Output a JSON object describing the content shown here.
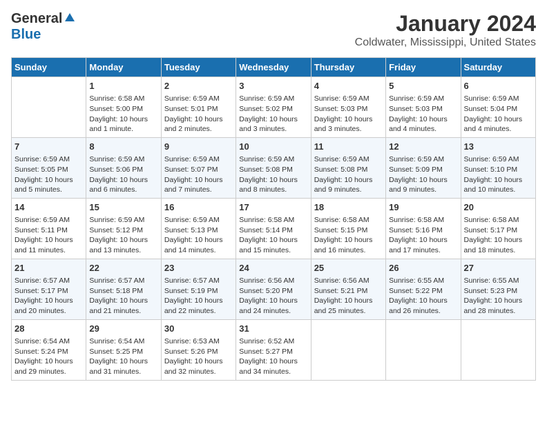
{
  "logo": {
    "general": "General",
    "blue": "Blue"
  },
  "title": "January 2024",
  "subtitle": "Coldwater, Mississippi, United States",
  "headers": [
    "Sunday",
    "Monday",
    "Tuesday",
    "Wednesday",
    "Thursday",
    "Friday",
    "Saturday"
  ],
  "weeks": [
    [
      {
        "day": "",
        "info": ""
      },
      {
        "day": "1",
        "info": "Sunrise: 6:58 AM\nSunset: 5:00 PM\nDaylight: 10 hours\nand 1 minute."
      },
      {
        "day": "2",
        "info": "Sunrise: 6:59 AM\nSunset: 5:01 PM\nDaylight: 10 hours\nand 2 minutes."
      },
      {
        "day": "3",
        "info": "Sunrise: 6:59 AM\nSunset: 5:02 PM\nDaylight: 10 hours\nand 3 minutes."
      },
      {
        "day": "4",
        "info": "Sunrise: 6:59 AM\nSunset: 5:03 PM\nDaylight: 10 hours\nand 3 minutes."
      },
      {
        "day": "5",
        "info": "Sunrise: 6:59 AM\nSunset: 5:03 PM\nDaylight: 10 hours\nand 4 minutes."
      },
      {
        "day": "6",
        "info": "Sunrise: 6:59 AM\nSunset: 5:04 PM\nDaylight: 10 hours\nand 4 minutes."
      }
    ],
    [
      {
        "day": "7",
        "info": "Sunrise: 6:59 AM\nSunset: 5:05 PM\nDaylight: 10 hours\nand 5 minutes."
      },
      {
        "day": "8",
        "info": "Sunrise: 6:59 AM\nSunset: 5:06 PM\nDaylight: 10 hours\nand 6 minutes."
      },
      {
        "day": "9",
        "info": "Sunrise: 6:59 AM\nSunset: 5:07 PM\nDaylight: 10 hours\nand 7 minutes."
      },
      {
        "day": "10",
        "info": "Sunrise: 6:59 AM\nSunset: 5:08 PM\nDaylight: 10 hours\nand 8 minutes."
      },
      {
        "day": "11",
        "info": "Sunrise: 6:59 AM\nSunset: 5:08 PM\nDaylight: 10 hours\nand 9 minutes."
      },
      {
        "day": "12",
        "info": "Sunrise: 6:59 AM\nSunset: 5:09 PM\nDaylight: 10 hours\nand 9 minutes."
      },
      {
        "day": "13",
        "info": "Sunrise: 6:59 AM\nSunset: 5:10 PM\nDaylight: 10 hours\nand 10 minutes."
      }
    ],
    [
      {
        "day": "14",
        "info": "Sunrise: 6:59 AM\nSunset: 5:11 PM\nDaylight: 10 hours\nand 11 minutes."
      },
      {
        "day": "15",
        "info": "Sunrise: 6:59 AM\nSunset: 5:12 PM\nDaylight: 10 hours\nand 13 minutes."
      },
      {
        "day": "16",
        "info": "Sunrise: 6:59 AM\nSunset: 5:13 PM\nDaylight: 10 hours\nand 14 minutes."
      },
      {
        "day": "17",
        "info": "Sunrise: 6:58 AM\nSunset: 5:14 PM\nDaylight: 10 hours\nand 15 minutes."
      },
      {
        "day": "18",
        "info": "Sunrise: 6:58 AM\nSunset: 5:15 PM\nDaylight: 10 hours\nand 16 minutes."
      },
      {
        "day": "19",
        "info": "Sunrise: 6:58 AM\nSunset: 5:16 PM\nDaylight: 10 hours\nand 17 minutes."
      },
      {
        "day": "20",
        "info": "Sunrise: 6:58 AM\nSunset: 5:17 PM\nDaylight: 10 hours\nand 18 minutes."
      }
    ],
    [
      {
        "day": "21",
        "info": "Sunrise: 6:57 AM\nSunset: 5:17 PM\nDaylight: 10 hours\nand 20 minutes."
      },
      {
        "day": "22",
        "info": "Sunrise: 6:57 AM\nSunset: 5:18 PM\nDaylight: 10 hours\nand 21 minutes."
      },
      {
        "day": "23",
        "info": "Sunrise: 6:57 AM\nSunset: 5:19 PM\nDaylight: 10 hours\nand 22 minutes."
      },
      {
        "day": "24",
        "info": "Sunrise: 6:56 AM\nSunset: 5:20 PM\nDaylight: 10 hours\nand 24 minutes."
      },
      {
        "day": "25",
        "info": "Sunrise: 6:56 AM\nSunset: 5:21 PM\nDaylight: 10 hours\nand 25 minutes."
      },
      {
        "day": "26",
        "info": "Sunrise: 6:55 AM\nSunset: 5:22 PM\nDaylight: 10 hours\nand 26 minutes."
      },
      {
        "day": "27",
        "info": "Sunrise: 6:55 AM\nSunset: 5:23 PM\nDaylight: 10 hours\nand 28 minutes."
      }
    ],
    [
      {
        "day": "28",
        "info": "Sunrise: 6:54 AM\nSunset: 5:24 PM\nDaylight: 10 hours\nand 29 minutes."
      },
      {
        "day": "29",
        "info": "Sunrise: 6:54 AM\nSunset: 5:25 PM\nDaylight: 10 hours\nand 31 minutes."
      },
      {
        "day": "30",
        "info": "Sunrise: 6:53 AM\nSunset: 5:26 PM\nDaylight: 10 hours\nand 32 minutes."
      },
      {
        "day": "31",
        "info": "Sunrise: 6:52 AM\nSunset: 5:27 PM\nDaylight: 10 hours\nand 34 minutes."
      },
      {
        "day": "",
        "info": ""
      },
      {
        "day": "",
        "info": ""
      },
      {
        "day": "",
        "info": ""
      }
    ]
  ]
}
